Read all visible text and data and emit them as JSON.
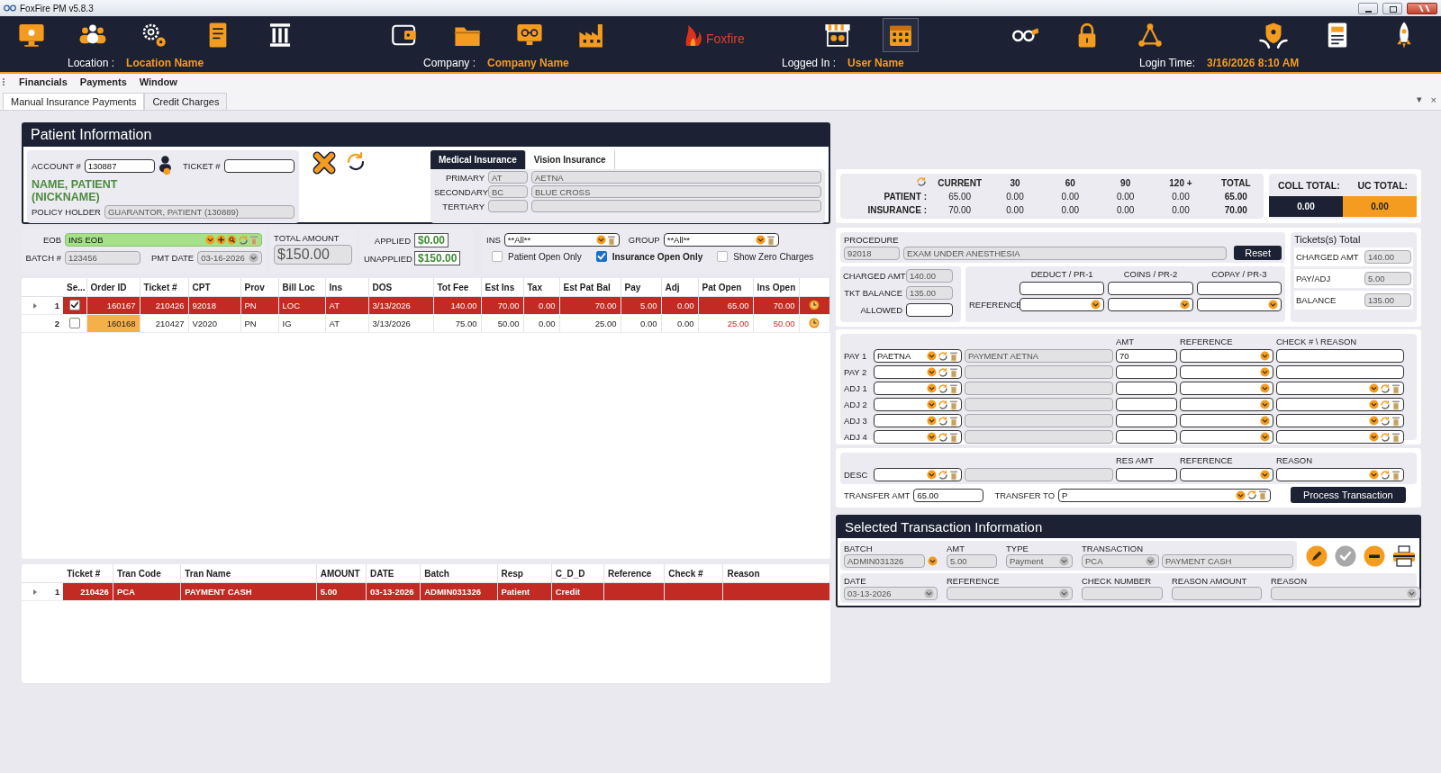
{
  "window": {
    "title": "FoxFire PM v5.8.3"
  },
  "toolbar": [
    {
      "selected": false
    },
    {
      "selected": false
    },
    {
      "selected": false
    },
    {
      "selected": false
    },
    {
      "selected": false
    },
    {
      "selected": false
    },
    {
      "selected": false
    },
    {
      "selected": false
    },
    {
      "selected": false
    },
    {
      "selected": false
    },
    {
      "selected": true
    },
    {
      "selected": false
    },
    {
      "selected": false
    },
    {
      "selected": false
    },
    {
      "selected": false
    },
    {
      "selected": false
    },
    {
      "selected": false
    }
  ],
  "logo": "Foxfire",
  "info_bar": [
    {
      "label": "Location :",
      "value": "Location Name"
    },
    {
      "label": "Company :",
      "value": "Company Name"
    },
    {
      "label": "Logged In :",
      "value": "User Name"
    },
    {
      "label": "Login Time:",
      "value": "3/16/2026 8:10 AM"
    }
  ],
  "menu": [
    "Financials",
    "Payments",
    "Window"
  ],
  "tabs": [
    {
      "label": "Manual Insurance Payments",
      "selected": true
    },
    {
      "label": "Credit Charges",
      "selected": false
    }
  ],
  "tab_controls": [
    "▾",
    "×"
  ],
  "patient": {
    "title": "Patient Information",
    "account_label": "ACCOUNT #",
    "account": "130887",
    "ticket_label": "TICKET #",
    "name": "NAME, PATIENT (NICKNAME)",
    "policy_holder_label": "POLICY HOLDER",
    "policy_holder": "GUARANTOR, PATIENT (130889)",
    "insurance_tabs": [
      {
        "label": "Medical Insurance",
        "selected": true
      },
      {
        "label": "Vision Insurance",
        "selected": false
      }
    ],
    "insurance": [
      {
        "label": "PRIMARY",
        "code": "AT",
        "name": "AETNA"
      },
      {
        "label": "SECONDARY",
        "code": "BC",
        "name": "BLUE CROSS"
      },
      {
        "label": "TERTIARY"
      }
    ]
  },
  "eob": {
    "eob_label": "EOB",
    "eob": "INS EOB",
    "batch_label": "BATCH #",
    "batch": "123456",
    "pmt_date_label": "PMT DATE",
    "pmt_date": "03-16-2026",
    "total_label": "TOTAL AMOUNT",
    "total": "$150.00",
    "applied_label": "APPLIED",
    "applied": "$0.00",
    "unapplied_label": "UNAPPLIED",
    "unapplied": "$150.00"
  },
  "filters": {
    "ins_label": "INS",
    "ins": "**All**",
    "group_label": "GROUP",
    "group": "**All**",
    "checks": [
      {
        "label": "Patient Open Only",
        "checked": false
      },
      {
        "label": "Insurance Open Only",
        "checked": true
      },
      {
        "label": "Show Zero Charges",
        "checked": false
      }
    ]
  },
  "orders": {
    "select_column": "Se...",
    "columns": [
      "Order ID",
      "Ticket #",
      "CPT",
      "Prov",
      "Bill Loc",
      "Ins",
      "DOS",
      "Tot Fee",
      "Est Ins",
      "Tax",
      "Est Pat Bal",
      "Pay",
      "Adj",
      "Pat Open",
      "Ins Open"
    ],
    "rows": [
      {
        "current": true,
        "row_num": "1",
        "checked": true,
        "selected": true,
        "highlighted": false,
        "alert": false,
        "cells": [
          "160167",
          "210426",
          "92018",
          "PN",
          "LOC",
          "AT",
          "3/13/2026",
          "140.00",
          "70.00",
          "0.00",
          "70.00",
          "5.00",
          "0.00",
          "65.00",
          "70.00"
        ]
      },
      {
        "current": false,
        "row_num": "2",
        "checked": false,
        "selected": false,
        "highlighted": true,
        "alert": true,
        "cells": [
          "160168",
          "210427",
          "V2020",
          "PN",
          "IG",
          "AT",
          "3/13/2026",
          "75.00",
          "50.00",
          "0.00",
          "25.00",
          "0.00",
          "0.00",
          "25.00",
          "50.00"
        ]
      }
    ]
  },
  "transactions": {
    "columns": [
      "Ticket #",
      "Tran Code",
      "Tran Name",
      "AMOUNT",
      "DATE",
      "Batch",
      "Resp",
      "C_D_D",
      "Reference",
      "Check #",
      "Reason"
    ],
    "rows": [
      {
        "current": true,
        "row_num": "1",
        "selected": true,
        "cells": [
          "210426",
          "PCA",
          "PAYMENT CASH",
          "5.00",
          "03-13-2026",
          "ADMIN031326",
          "Patient",
          "Credit"
        ]
      }
    ]
  },
  "aging": {
    "headers": [
      "CURRENT",
      "30",
      "60",
      "90",
      "120 +",
      "TOTAL"
    ],
    "rows": [
      {
        "label": "PATIENT :",
        "values": [
          "65.00",
          "0.00",
          "0.00",
          "0.00",
          "0.00",
          "65.00"
        ]
      },
      {
        "label": "INSURANCE :",
        "values": [
          "70.00",
          "0.00",
          "0.00",
          "0.00",
          "0.00",
          "70.00"
        ]
      }
    ],
    "coll_label": "COLL TOTAL:",
    "coll": "0.00",
    "uc_label": "UC TOTAL:",
    "uc": "0.00"
  },
  "procedure": {
    "label": "PROCEDURE",
    "code": "92018",
    "desc": "EXAM UNDER ANESTHESIA",
    "reset": "Reset",
    "amounts": [
      {
        "label": "CHARGED AMT",
        "value": "140.00"
      },
      {
        "label": "TKT BALANCE",
        "value": "135.00"
      },
      {
        "label": "ALLOWED"
      }
    ],
    "pr_headers": [
      "DEDUCT / PR-1",
      "COINS / PR-2",
      "COPAY / PR-3"
    ],
    "reference_label": "REFERENCE",
    "tickets_title": "Tickets(s) Total",
    "tickets": [
      {
        "label": "CHARGED AMT",
        "value": "140.00"
      },
      {
        "label": "PAY/ADJ",
        "value": "5.00"
      },
      {
        "label": "BALANCE",
        "value": "135.00"
      }
    ]
  },
  "payments": {
    "headers": [
      "AMT",
      "REFERENCE",
      "CHECK # \\ REASON"
    ],
    "rows": [
      {
        "label": "PAY 1",
        "kind": "pay",
        "code": "PAETNA",
        "desc": "PAYMENT AETNA",
        "amt": "70"
      },
      {
        "label": "PAY 2",
        "kind": "pay"
      },
      {
        "label": "ADJ 1",
        "kind": "adj"
      },
      {
        "label": "ADJ 2",
        "kind": "adj"
      },
      {
        "label": "ADJ 3",
        "kind": "adj"
      },
      {
        "label": "ADJ 4",
        "kind": "adj"
      }
    ]
  },
  "desc_panel": {
    "headers": [
      "RES AMT",
      "REFERENCE",
      "REASON"
    ],
    "desc_label": "DESC",
    "transfer_amt_label": "TRANSFER AMT",
    "transfer_amt": "65.00",
    "transfer_to_label": "TRANSFER TO",
    "transfer_to": "P",
    "process": "Process Transaction"
  },
  "selected_transaction": {
    "title": "Selected Transaction Information",
    "batch_label": "BATCH",
    "batch": "ADMIN031326",
    "amt_label": "AMT",
    "amt": "5.00",
    "type_label": "TYPE",
    "type": "Payment",
    "transaction_label": "TRANSACTION",
    "transaction_code": "PCA",
    "transaction_name": "PAYMENT CASH",
    "date_label": "DATE",
    "date": "03-13-2026",
    "reference_label": "REFERENCE",
    "check_label": "CHECK NUMBER",
    "reason_amount_label": "REASON AMOUNT",
    "reason_label": "REASON"
  }
}
